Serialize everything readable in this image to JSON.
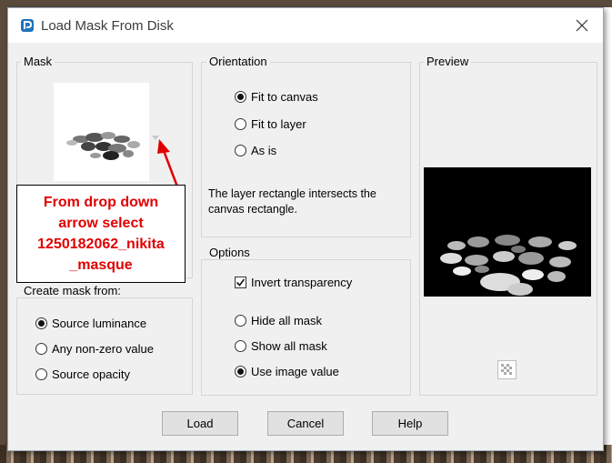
{
  "window": {
    "title": "Load Mask From Disk"
  },
  "mask_panel": {
    "label": "Mask"
  },
  "annotation": {
    "lines": [
      "From drop down",
      "arrow select",
      "1250182062_nikita",
      "_masque"
    ]
  },
  "create_mask": {
    "label": "Create mask from:",
    "options": [
      {
        "label": "Source luminance",
        "selected": true
      },
      {
        "label": "Any non-zero value",
        "selected": false
      },
      {
        "label": "Source opacity",
        "selected": false
      }
    ]
  },
  "orientation": {
    "label": "Orientation",
    "options": [
      {
        "label": "Fit to canvas",
        "selected": true
      },
      {
        "label": "Fit to layer",
        "selected": false
      },
      {
        "label": "As is",
        "selected": false
      }
    ],
    "description": "The layer rectangle intersects the canvas rectangle."
  },
  "options": {
    "label": "Options",
    "invert_transparency": {
      "label": "Invert transparency",
      "checked": true
    },
    "radios": [
      {
        "label": "Hide all mask",
        "selected": false
      },
      {
        "label": "Show all mask",
        "selected": false
      },
      {
        "label": "Use image value",
        "selected": true
      }
    ]
  },
  "preview": {
    "label": "Preview"
  },
  "buttons": {
    "load": "Load",
    "cancel": "Cancel",
    "help": "Help"
  },
  "colors": {
    "annotation_red": "#e00000",
    "dialog_bg": "#f0f0f0"
  }
}
